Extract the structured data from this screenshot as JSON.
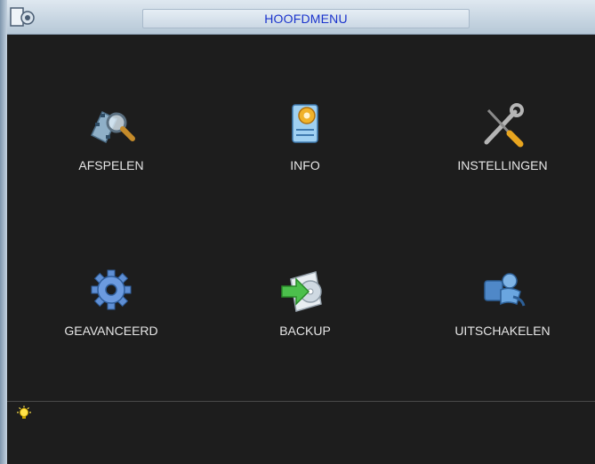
{
  "window": {
    "title": "HOOFDMENU"
  },
  "menu": {
    "items": [
      {
        "label": "AFSPELEN",
        "icon": "playback-search-icon"
      },
      {
        "label": "INFO",
        "icon": "info-document-gear-icon"
      },
      {
        "label": "INSTELLINGEN",
        "icon": "tools-wrench-screwdriver-icon"
      },
      {
        "label": "GEAVANCEERD",
        "icon": "gear-icon"
      },
      {
        "label": "BACKUP",
        "icon": "backup-disc-arrow-icon"
      },
      {
        "label": "UITSCHAKELEN",
        "icon": "shutdown-user-icon"
      }
    ]
  },
  "status": {
    "icon": "lightbulb-tip-icon"
  },
  "colors": {
    "title_text": "#1a33cc",
    "background": "#1d1d1d",
    "label_text": "#e6e6e6"
  }
}
